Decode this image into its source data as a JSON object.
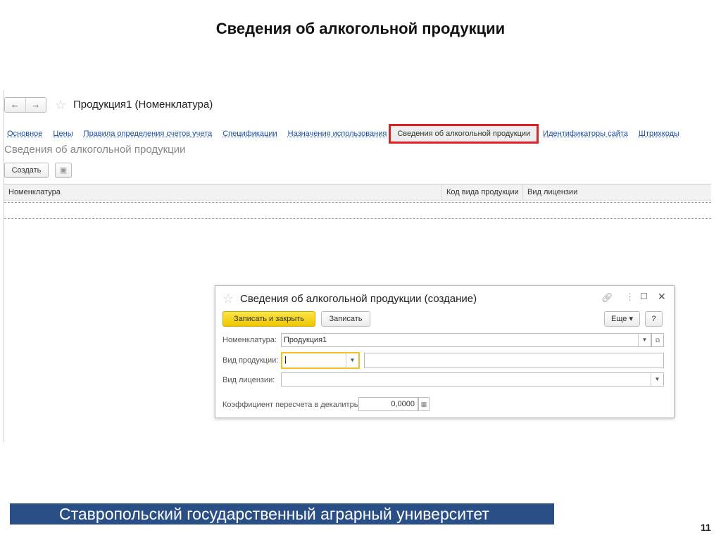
{
  "slide": {
    "title": "Сведения об алкогольной продукции",
    "footer": "Ставропольский государственный аграрный университет",
    "page_number": "11"
  },
  "form": {
    "back": "←",
    "forward": "→",
    "title": "Продукция1 (Номенклатура)",
    "tabs": [
      "Основное",
      "Цены",
      "Правила определения счетов учета",
      "Спецификации",
      "Назначения использования",
      "Сведения об алкогольной продукции",
      "Идентификаторы сайта",
      "Штрихкоды"
    ],
    "section_title": "Сведения об алкогольной продукции",
    "create_label": "Создать",
    "columns": [
      "Номенклатура",
      "Код вида продукции",
      "Вид лицензии"
    ]
  },
  "dialog": {
    "title": "Сведения об алкогольной продукции (создание)",
    "save_close": "Записать и закрыть",
    "save": "Записать",
    "more": "Еще",
    "help": "?",
    "nomenclature_label": "Номенклатура:",
    "nomenclature_value": "Продукция1",
    "product_type_label": "Вид продукции:",
    "license_label": "Вид лицензии:",
    "coef_label": "Коэффициент пересчета в декалитры:",
    "coef_value": "0,0000"
  },
  "colors": {
    "highlight": "#e02020",
    "banner": "#2a4f86",
    "primary_button": "#f5d000"
  }
}
